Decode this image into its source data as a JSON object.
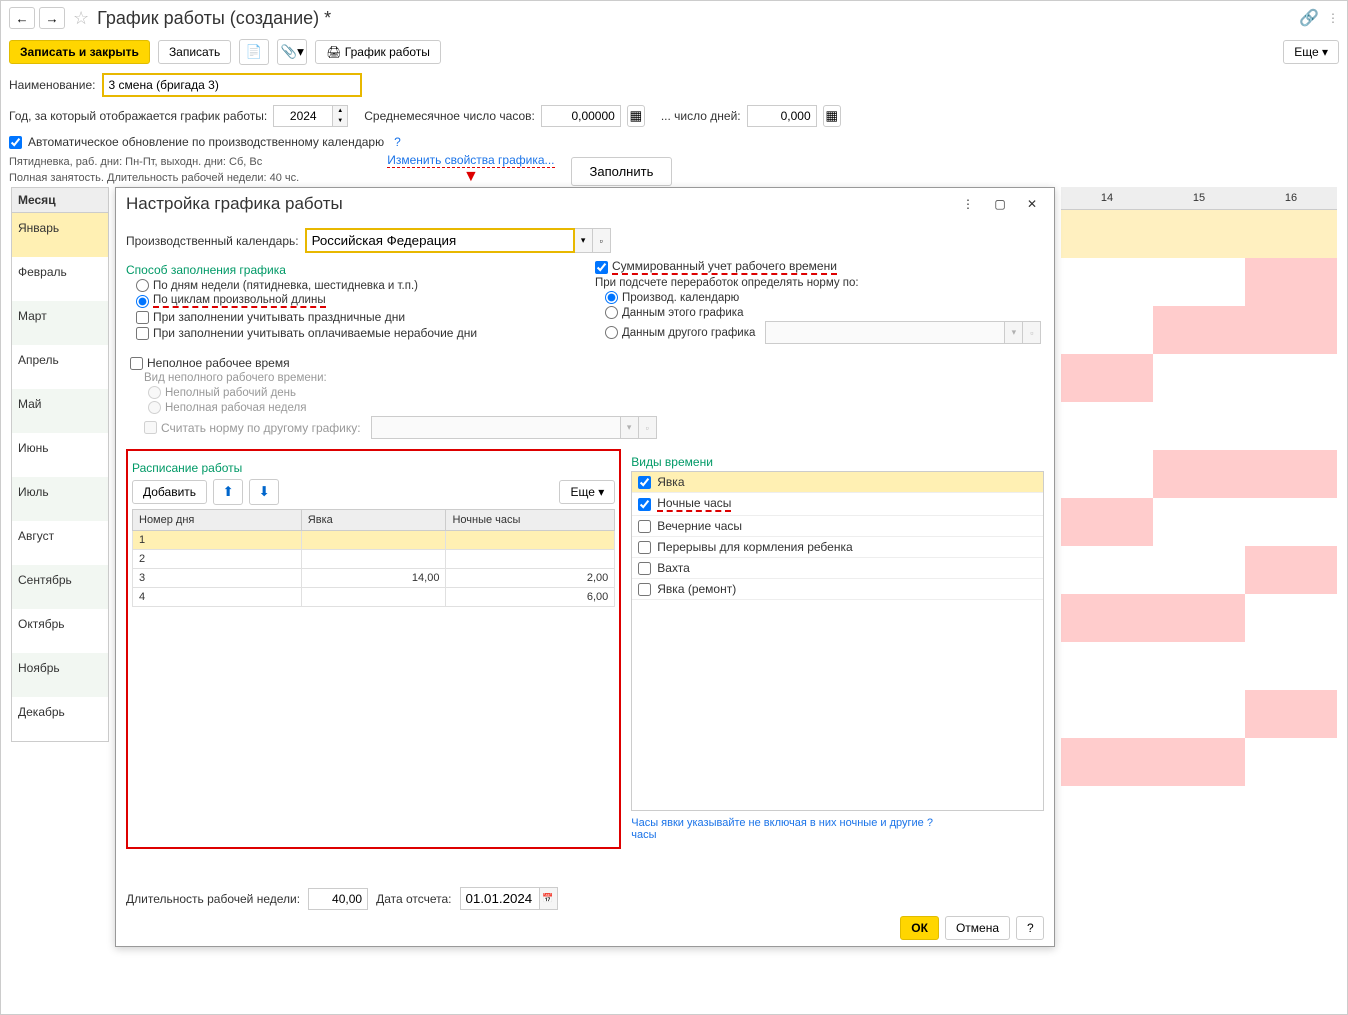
{
  "header": {
    "title": "График работы (создание) *"
  },
  "toolbar": {
    "save_close": "Записать и закрыть",
    "save": "Записать",
    "schedule": "График работы",
    "more": "Еще"
  },
  "form": {
    "name_label": "Наименование:",
    "name_value": "3 смена (бригада 3)",
    "year_label": "Год, за который отображается график работы:",
    "year_value": "2024",
    "avg_hours_label": "Среднемесячное число часов:",
    "avg_hours_value": "0,00000",
    "days_label": "... число дней:",
    "days_value": "0,000",
    "auto_update": "Автоматическое обновление по производственному календарю",
    "info1": "Пятидневка, раб. дни: Пн-Пт, выходн. дни: Сб, Вс",
    "info2": "Полная занятость. Длительность рабочей недели: 40 чс.",
    "change_props": "Изменить свойства графика...",
    "fill_btn": "Заполнить"
  },
  "months": {
    "header": "Месяц",
    "items": [
      "Январь",
      "Февраль",
      "Март",
      "Апрель",
      "Май",
      "Июнь",
      "Июль",
      "Август",
      "Сентябрь",
      "Октябрь",
      "Ноябрь",
      "Декабрь"
    ]
  },
  "calendar_cols": [
    "14",
    "15",
    "16"
  ],
  "dialog": {
    "title": "Настройка графика работы",
    "calendar_label": "Производственный календарь:",
    "calendar_value": "Российская Федерация",
    "fill_method_title": "Способ заполнения графика",
    "by_weekdays": "По дням недели (пятидневка, шестидневка и т.п.)",
    "by_cycles": "По циклам произвольной длины",
    "holidays": "При заполнении учитывать праздничные дни",
    "paid_nonwork": "При заполнении учитывать оплачиваемые нерабочие дни",
    "summed": "Суммированный учет рабочего времени",
    "overtime_label": "При подсчете переработок определять норму по:",
    "by_prod_cal": "Производ. календарю",
    "by_this": "Данным этого графика",
    "by_other": "Данным другого графика",
    "parttime": "Неполное рабочее время",
    "parttime_type": "Вид неполного рабочего времени:",
    "parttime_day": "Неполный рабочий день",
    "parttime_week": "Неполная рабочая неделя",
    "norm_other": "Считать норму по другому графику:",
    "schedule_title": "Расписание работы",
    "add_btn": "Добавить",
    "more_btn": "Еще",
    "col_daynum": "Номер дня",
    "col_yavka": "Явка",
    "col_night": "Ночные часы",
    "rows": [
      {
        "n": "1",
        "y": "",
        "night": ""
      },
      {
        "n": "2",
        "y": "",
        "night": ""
      },
      {
        "n": "3",
        "y": "14,00",
        "night": "2,00"
      },
      {
        "n": "4",
        "y": "",
        "night": "6,00"
      }
    ],
    "timetypes_title": "Виды времени",
    "timetypes": [
      {
        "label": "Явка",
        "checked": true
      },
      {
        "label": "Ночные часы",
        "checked": true
      },
      {
        "label": "Вечерние часы",
        "checked": false
      },
      {
        "label": "Перерывы для кормления ребенка",
        "checked": false
      },
      {
        "label": "Вахта",
        "checked": false
      },
      {
        "label": "Явка (ремонт)",
        "checked": false
      }
    ],
    "yavka_hint": "Часы явки указывайте не включая в них ночные и другие",
    "hours_link": "часы",
    "week_len_label": "Длительность рабочей недели:",
    "week_len_value": "40,00",
    "start_date_label": "Дата отсчета:",
    "start_date_value": "01.01.2024",
    "ok": "ОК",
    "cancel": "Отмена",
    "help": "?"
  }
}
